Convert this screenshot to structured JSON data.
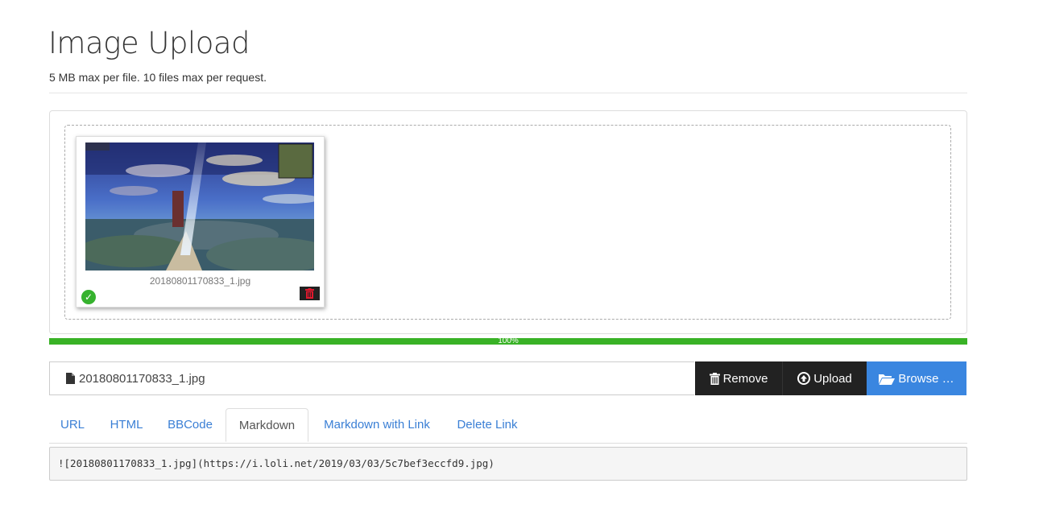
{
  "header": {
    "title": "Image Upload",
    "subtitle": "5 MB max per file. 10 files max per request."
  },
  "preview": {
    "file_name": "20180801170833_1.jpg",
    "status_icon": "check-circle-icon",
    "delete_icon": "trash-icon"
  },
  "progress": {
    "percent": 100,
    "label": "100%",
    "color": "#39b226"
  },
  "file_bar": {
    "file_name": "20180801170833_1.jpg",
    "remove_label": "Remove",
    "upload_label": "Upload",
    "browse_label": "Browse …"
  },
  "tabs": [
    {
      "label": "URL",
      "active": false
    },
    {
      "label": "HTML",
      "active": false
    },
    {
      "label": "BBCode",
      "active": false
    },
    {
      "label": "Markdown",
      "active": true
    },
    {
      "label": "Markdown with Link",
      "active": false
    },
    {
      "label": "Delete Link",
      "active": false
    }
  ],
  "output": {
    "code": "![20180801170833_1.jpg](https://i.loli.net/2019/03/03/5c7bef3eccfd9.jpg)"
  },
  "colors": {
    "accent": "#3a86e0",
    "dark_button": "#222222",
    "success": "#36b22e",
    "link": "#3a7fd5"
  }
}
